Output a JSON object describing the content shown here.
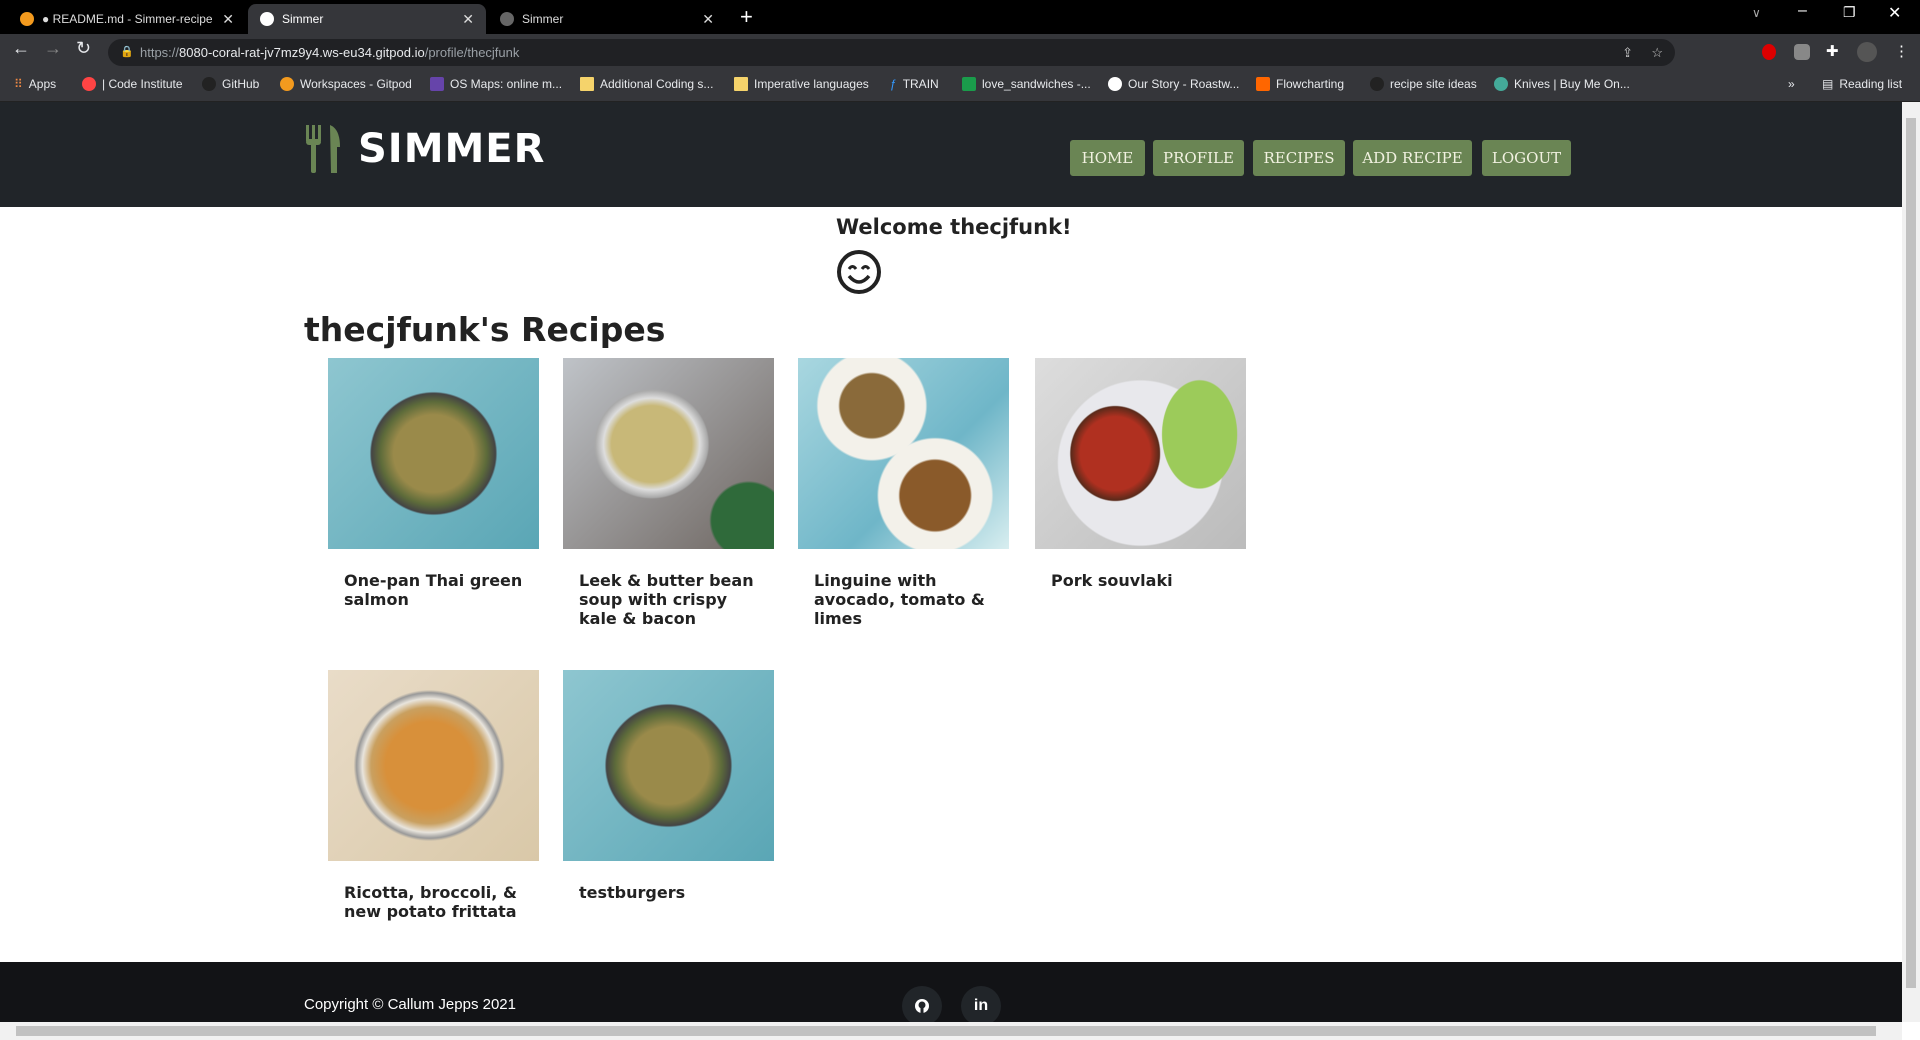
{
  "browser": {
    "tabs": [
      {
        "title": "● README.md - Simmer-recipe-s",
        "active": false
      },
      {
        "title": "Simmer",
        "active": true
      },
      {
        "title": "Simmer",
        "active": false
      }
    ],
    "url_prefix": "https://",
    "url_host": "8080-coral-rat-jv7mz9y4.ws-eu34.gitpod.io",
    "url_path": "/profile/thecjfunk",
    "bookmarks": [
      "Apps",
      "| Code Institute",
      "GitHub",
      "Workspaces - Gitpod",
      "OS Maps: online m...",
      "Additional Coding s...",
      "Imperative languages",
      "TRAIN",
      "love_sandwiches -...",
      "Our Story - Roastw...",
      "Flowcharting",
      "recipe site ideas",
      "Knives | Buy Me On..."
    ],
    "reading_list": "Reading list",
    "overflow": "»"
  },
  "site": {
    "logo": "SIMMER",
    "nav": [
      "HOME",
      "PROFILE",
      "RECIPES",
      "ADD RECIPE",
      "LOGOUT"
    ],
    "accent": "#6a8554",
    "welcome": "Welcome thecjfunk!",
    "heading": "thecjfunk's Recipes",
    "recipes": [
      {
        "title": "One-pan Thai green salmon"
      },
      {
        "title": "Leek & butter bean soup with crispy kale & bacon"
      },
      {
        "title": "Linguine with avocado, tomato & limes"
      },
      {
        "title": "Pork souvlaki"
      },
      {
        "title": "Ricotta, broccoli, & new potato frittata"
      },
      {
        "title": "testburgers"
      }
    ],
    "footer": {
      "copyright": "Copyright © Callum Jepps 2021",
      "github": "",
      "linkedin": "in"
    }
  }
}
